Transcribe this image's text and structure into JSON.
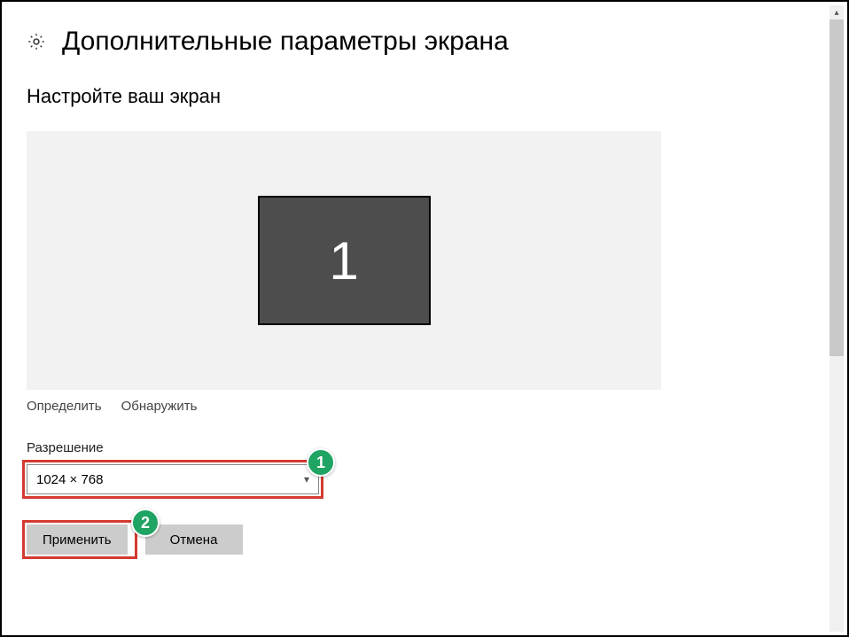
{
  "header": {
    "title": "Дополнительные параметры экрана"
  },
  "section": {
    "title": "Настройте ваш экран"
  },
  "monitor": {
    "number": "1"
  },
  "links": {
    "identify": "Определить",
    "detect": "Обнаружить"
  },
  "resolution": {
    "label": "Разрешение",
    "value": "1024 × 768"
  },
  "buttons": {
    "apply": "Применить",
    "cancel": "Отмена"
  },
  "annotations": {
    "badge1": "1",
    "badge2": "2"
  }
}
